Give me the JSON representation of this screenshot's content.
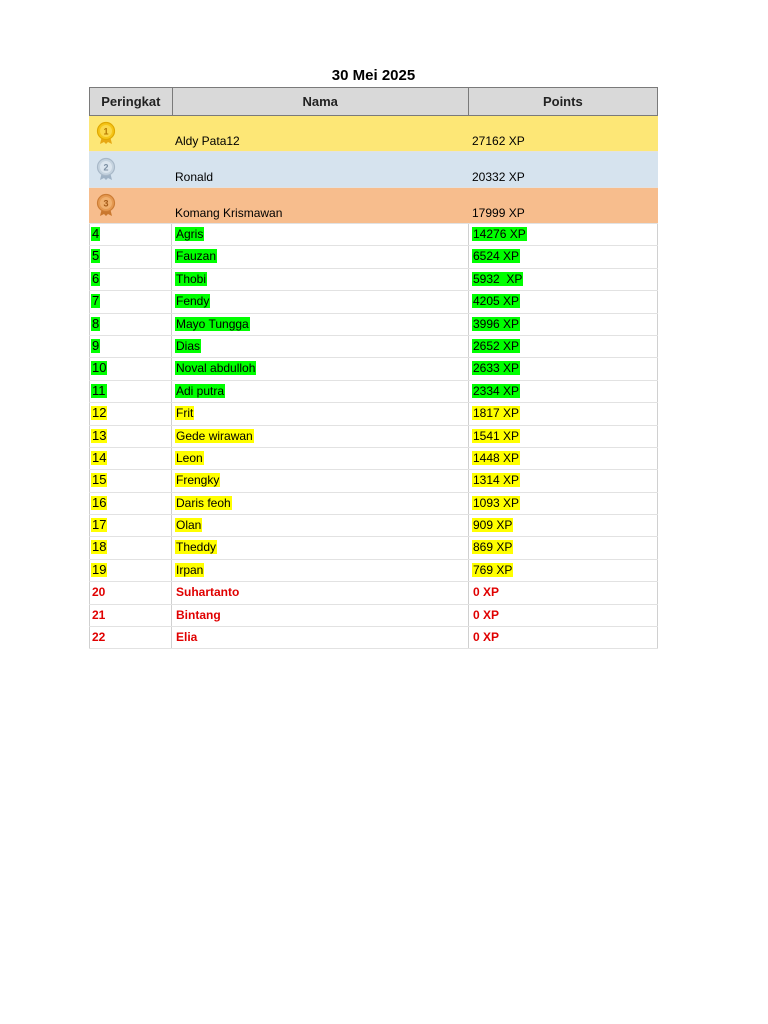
{
  "title": "30 Mei 2025",
  "headers": {
    "rank": "Peringkat",
    "name": "Nama",
    "points": "Points"
  },
  "colors": {
    "gold_row": "#fde776",
    "silver_row": "#d6e3ee",
    "bronze_row": "#f7bd8d",
    "green": "#00ff00",
    "yellow": "#ffff00",
    "red_text": "#e00000"
  },
  "top3": [
    {
      "rank": "1",
      "medal_icon": "gold-medal-icon",
      "name": "Aldy Pata12",
      "points": "27162 XP"
    },
    {
      "rank": "2",
      "medal_icon": "silver-medal-icon",
      "name": "Ronald",
      "points": "20332 XP"
    },
    {
      "rank": "3",
      "medal_icon": "bronze-medal-icon",
      "name": "Komang Krismawan",
      "points": "17999 XP"
    }
  ],
  "rows": [
    {
      "rank": "4",
      "name": "Agris",
      "points": "14276 XP",
      "style": "green"
    },
    {
      "rank": "5",
      "name": "Fauzan",
      "points": "6524 XP",
      "style": "green"
    },
    {
      "rank": "6",
      "name": "Thobi",
      "points": "5932  XP",
      "style": "green"
    },
    {
      "rank": "7",
      "name": "Fendy",
      "points": "4205 XP",
      "style": "green"
    },
    {
      "rank": "8",
      "name": "Mayo Tungga",
      "points": "3996 XP",
      "style": "green"
    },
    {
      "rank": "9",
      "name": "Dias",
      "points": "2652 XP",
      "style": "green"
    },
    {
      "rank": "10",
      "name": "Noval abdulloh",
      "points": "2633 XP",
      "style": "green"
    },
    {
      "rank": "11",
      "name": "Adi putra",
      "points": "2334 XP",
      "style": "green"
    },
    {
      "rank": "12",
      "name": "Frit",
      "points": "1817 XP",
      "style": "yellow"
    },
    {
      "rank": "13",
      "name": "Gede wirawan",
      "points": "1541 XP",
      "style": "yellow"
    },
    {
      "rank": "14",
      "name": "Leon",
      "points": "1448 XP",
      "style": "yellow"
    },
    {
      "rank": "15",
      "name": "Frengky",
      "points": "1314 XP",
      "style": "yellow"
    },
    {
      "rank": "16",
      "name": "Daris feoh",
      "points": "1093 XP",
      "style": "yellow"
    },
    {
      "rank": "17",
      "name": "Olan",
      "points": "909 XP",
      "style": "yellow"
    },
    {
      "rank": "18",
      "name": "Theddy",
      "points": "869 XP",
      "style": "yellow"
    },
    {
      "rank": "19",
      "name": "Irpan",
      "points": "769 XP",
      "style": "yellow"
    },
    {
      "rank": "20",
      "name": "Suhartanto",
      "points": "0 XP",
      "style": "red"
    },
    {
      "rank": "21",
      "name": "Bintang",
      "points": "0 XP",
      "style": "red"
    },
    {
      "rank": "22",
      "name": "Elia",
      "points": "0 XP",
      "style": "red"
    }
  ]
}
